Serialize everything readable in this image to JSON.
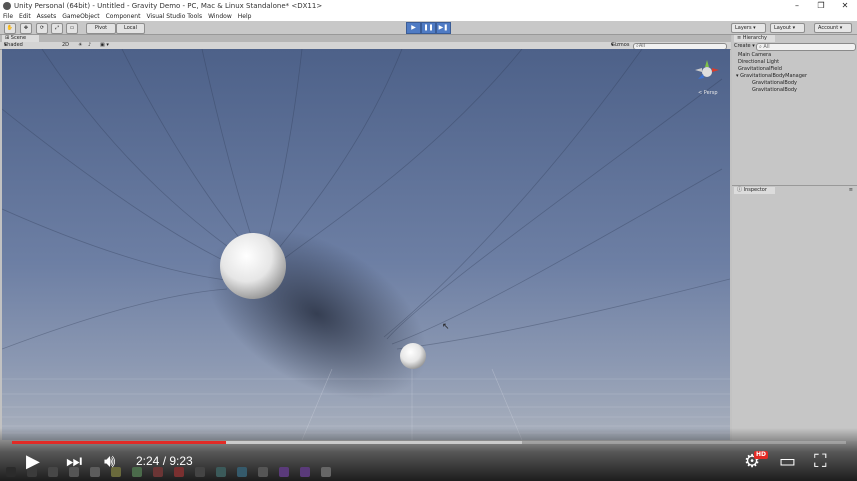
{
  "titlebar": {
    "title": "Unity Personal (64bit) - Untitled - Gravity Demo - PC, Mac & Linux Standalone* <DX11>",
    "minimize": "–",
    "maximize": "❐",
    "close": "✕"
  },
  "menubar": {
    "items": [
      "File",
      "Edit",
      "Assets",
      "GameObject",
      "Component",
      "Visual Studio Tools",
      "Window",
      "Help"
    ]
  },
  "toolbar": {
    "pivot_label": "Pivot",
    "local_label": "Local",
    "layers_label": "Layers",
    "layout_label": "Layout",
    "account_label": "Account"
  },
  "scene": {
    "tab_label": "Scene",
    "shading_mode": "Shaded",
    "mode_2d": "2D",
    "gizmos_label": "Gizmos",
    "search_placeholder": "All",
    "persp_label": "< Persp"
  },
  "hierarchy": {
    "tab_label": "Hierarchy",
    "create_label": "Create",
    "search_placeholder": "All",
    "items": [
      {
        "label": "Main Camera"
      },
      {
        "label": "Directional Light"
      },
      {
        "label": "GravitationalField"
      },
      {
        "label": "GravitationalBodyManager"
      },
      {
        "label": "GravitationalBody"
      },
      {
        "label": "GravitationalBody"
      }
    ]
  },
  "inspector": {
    "tab_label": "Inspector"
  },
  "video": {
    "current_time": "2:24",
    "duration": "9:23",
    "time_display": "2:24 / 9:23",
    "played_fraction": 0.256,
    "buffered_fraction": 0.612,
    "hd_badge": "HD",
    "accent_color": "#e22b26"
  },
  "icons": {
    "play": "play-icon",
    "next": "next-icon",
    "volume": "volume-icon",
    "settings": "gear-icon",
    "theater": "theater-mode-icon",
    "fullscreen": "fullscreen-icon"
  }
}
